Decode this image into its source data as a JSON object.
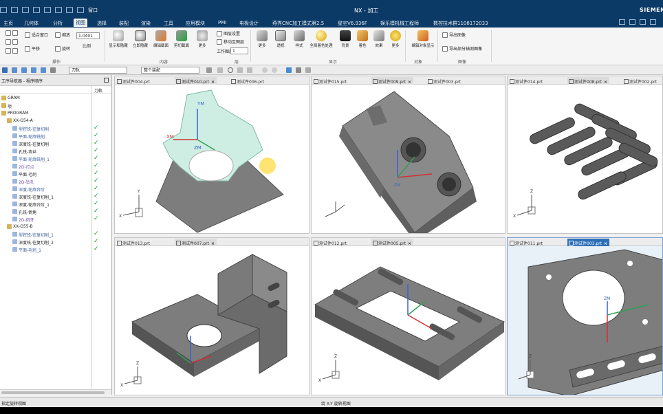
{
  "window": {
    "title": "NX - 加工",
    "brand": "SIEMENS",
    "window_menu": "窗口"
  },
  "menu_tabs": [
    {
      "label": "主页",
      "active": false
    },
    {
      "label": "几何体",
      "active": false
    },
    {
      "label": "分析",
      "active": false
    },
    {
      "label": "视图",
      "active": true
    },
    {
      "label": "选择",
      "active": false
    },
    {
      "label": "装配",
      "active": false
    },
    {
      "label": "渲染",
      "active": false
    },
    {
      "label": "工具",
      "active": false
    },
    {
      "label": "应用模块",
      "active": false
    },
    {
      "label": "PMI",
      "active": false
    },
    {
      "label": "电极设计",
      "active": false
    },
    {
      "label": "燕秀CNC加工模式第2.5",
      "active": false
    },
    {
      "label": "星空V6.936F",
      "active": false
    },
    {
      "label": "娱乐模机械工程师",
      "active": false
    },
    {
      "label": "数控技术群1108172033",
      "active": false
    }
  ],
  "ribbon": {
    "fit_window": "适合窗口",
    "pan": "平移",
    "zoom": "缩放",
    "rotate": "旋转",
    "scale_value": "1.0401",
    "scale_label": "比例",
    "group_operation": "操作",
    "show_hide_btn": "显示和隐藏",
    "immediate_hide_btn": "立即隐藏",
    "edit_section_btn": "编辑截面",
    "clip_section_btn": "剪切截面",
    "more1": "更多",
    "layer_settings": "图层设置",
    "move_to_layer": "移动至图层",
    "work_layer_label": "工作图层",
    "work_layer_value": "1",
    "more2": "更多",
    "group_visibility": "内容",
    "group_layer": "层",
    "style_btn": "透视",
    "shaded_btn": "样式",
    "full_spectrum_btn": "全局着色处理",
    "background_btn": "背景",
    "edges_btn": "着色",
    "effects_btn": "效果",
    "more3": "更多",
    "group_display": "显示",
    "edit_object_display": "编辑对象显示",
    "group_object": "对象",
    "export_image": "导出图像",
    "export_section_image": "导出部分轴测图像",
    "group_image": "图像"
  },
  "toolbar2": {
    "filter_select": "刀轨",
    "assembly_select": "整个装配"
  },
  "nav": {
    "title": "工序导航器 - 程序顺序",
    "col_tool": "刀轨",
    "rows": [
      {
        "label": "GRAM",
        "indent": 0,
        "check": false,
        "color": "#222"
      },
      {
        "label": "项",
        "indent": 0,
        "check": false,
        "color": "#222"
      },
      {
        "label": "PROGRAM",
        "indent": 0,
        "check": false,
        "color": "#222"
      },
      {
        "label": "XX-G54-A",
        "indent": 1,
        "check": false,
        "color": "#222"
      },
      {
        "label": "型腔铣-往复切削",
        "indent": 2,
        "check": true,
        "color": "#3f5fa0"
      },
      {
        "label": "平面-轮廓铣削",
        "indent": 2,
        "check": true,
        "color": "#3f5fa0"
      },
      {
        "label": "深度铣-往复切削",
        "indent": 2,
        "check": true,
        "color": "#222"
      },
      {
        "label": "孔铣-攻丝",
        "indent": 2,
        "check": true,
        "color": "#222"
      },
      {
        "label": "平面-轮廓铣削_1",
        "indent": 2,
        "check": true,
        "color": "#3f5fa0"
      },
      {
        "label": "2D-打点",
        "indent": 2,
        "check": true,
        "color": "#7a4fb0"
      },
      {
        "label": "平面-毛刺",
        "indent": 2,
        "check": true,
        "color": "#222"
      },
      {
        "label": "2D-钻孔",
        "indent": 2,
        "check": true,
        "color": "#7a4fb0"
      },
      {
        "label": "深度-轮廓台阶",
        "indent": 2,
        "check": true,
        "color": "#3f5fa0"
      },
      {
        "label": "深度铣-往复切削_1",
        "indent": 2,
        "check": true,
        "color": "#222"
      },
      {
        "label": "深度-轮廓台阶_1",
        "indent": 2,
        "check": true,
        "color": "#222"
      },
      {
        "label": "孔铣-倒角",
        "indent": 2,
        "check": true,
        "color": "#222"
      },
      {
        "label": "2D-倒牙",
        "indent": 2,
        "check": true,
        "color": "#7a4fb0"
      },
      {
        "label": "XX-G55-B",
        "indent": 1,
        "check": false,
        "color": "#222"
      },
      {
        "label": "型腔铣-往复切削_1",
        "indent": 2,
        "check": true,
        "color": "#3f5fa0"
      },
      {
        "label": "深度铣-往复切削_2",
        "indent": 2,
        "check": true,
        "color": "#222"
      },
      {
        "label": "平面-毛刺_1",
        "indent": 2,
        "check": true,
        "color": "#3f5fa0"
      }
    ]
  },
  "viewports": [
    {
      "tabs": [
        {
          "label": "测试件004.prt",
          "state": ""
        },
        {
          "label": "测试件010.prt",
          "state": "sel"
        },
        {
          "label": "测试件006.prt",
          "state": ""
        }
      ]
    },
    {
      "tabs": [
        {
          "label": "测试件015.prt",
          "state": ""
        },
        {
          "label": "测试件009.prt",
          "state": "sel"
        },
        {
          "label": "测试件003.prt",
          "state": ""
        }
      ]
    },
    {
      "tabs": [
        {
          "label": "测试件014.prt",
          "state": ""
        },
        {
          "label": "测试件008.prt",
          "state": "sel"
        },
        {
          "label": "测试件002.prt",
          "state": ""
        }
      ]
    },
    {
      "tabs": [
        {
          "label": "测试件013.prt",
          "state": ""
        },
        {
          "label": "测试件007.prt",
          "state": "sel"
        }
      ]
    },
    {
      "tabs": [
        {
          "label": "测试件012.prt",
          "state": ""
        },
        {
          "label": "测试件005.prt",
          "state": "sel"
        }
      ]
    },
    {
      "tabs": [
        {
          "label": "测试件011.prt",
          "state": ""
        },
        {
          "label": "测试件001.prt",
          "state": "cur"
        }
      ]
    }
  ],
  "axis_labels": {
    "x": "X",
    "y": "Y",
    "z": "Z",
    "xm": "XM",
    "ym": "YM",
    "zm": "ZM"
  },
  "status": {
    "left": "指定旋转视图",
    "middle": "绕 X-Y 旋转视图"
  }
}
